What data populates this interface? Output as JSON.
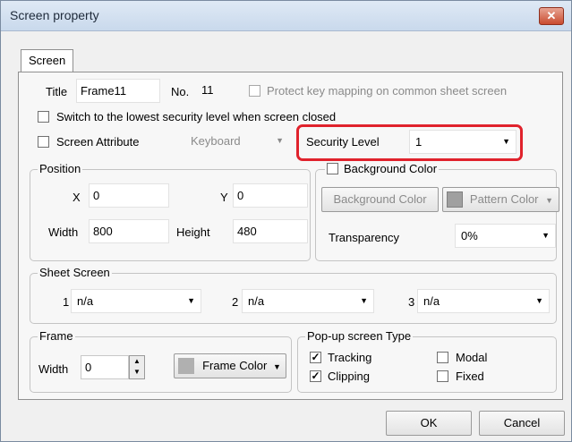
{
  "window": {
    "title": "Screen property",
    "close_glyph": "✕"
  },
  "tab": {
    "label": "Screen"
  },
  "title_row": {
    "title_label": "Title",
    "title_value": "Frame11",
    "no_label": "No.",
    "no_value": "11",
    "protect_label": "Protect key mapping on common sheet screen"
  },
  "switch_label": "Switch to the lowest security level when screen closed",
  "screen_attr": {
    "label": "Screen Attribute",
    "value": "Keyboard"
  },
  "security": {
    "label": "Security Level",
    "value": "1"
  },
  "position": {
    "legend": "Position",
    "x_label": "X",
    "x_value": "0",
    "y_label": "Y",
    "y_value": "0",
    "width_label": "Width",
    "width_value": "800",
    "height_label": "Height",
    "height_value": "480"
  },
  "background": {
    "legend": "Background Color",
    "bg_button": "Background Color",
    "pattern_button": "Pattern Color",
    "transparency_label": "Transparency",
    "transparency_value": "0%"
  },
  "sheet": {
    "legend": "Sheet Screen",
    "items": [
      {
        "num": "1",
        "value": "n/a"
      },
      {
        "num": "2",
        "value": "n/a"
      },
      {
        "num": "3",
        "value": "n/a"
      }
    ]
  },
  "frame": {
    "legend": "Frame",
    "width_label": "Width",
    "width_value": "0",
    "color_button": "Frame Color"
  },
  "popup": {
    "legend": "Pop-up screen Type",
    "tracking": "Tracking",
    "clipping": "Clipping",
    "modal": "Modal",
    "fixed": "Fixed"
  },
  "buttons": {
    "ok": "OK",
    "cancel": "Cancel"
  },
  "colors": {
    "highlight": "#e0222c",
    "close": "#c94b2f"
  }
}
